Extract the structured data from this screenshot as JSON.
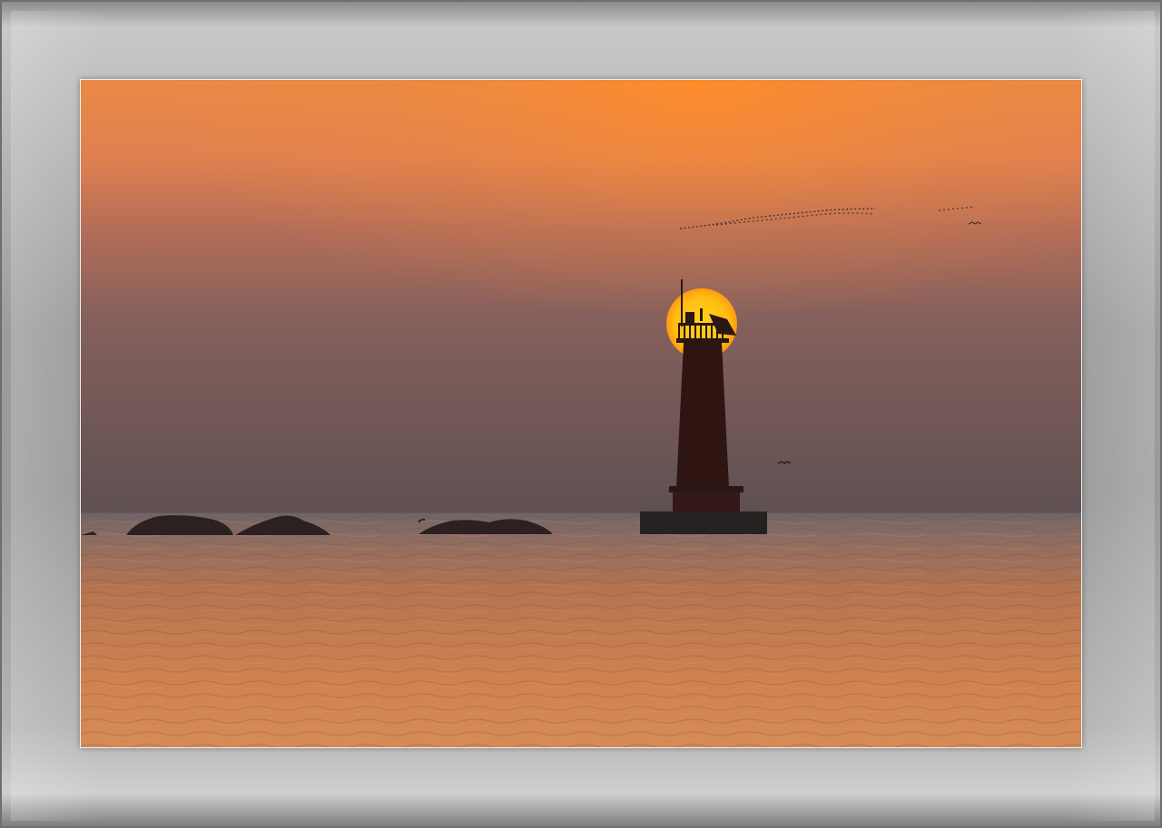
{
  "image": {
    "subject": "lighthouse",
    "colors": {
      "sky_top": "#f08a3c",
      "sky_mid": "#b86a52",
      "sky_low": "#6b5556",
      "sun": "#ffc21a",
      "sun_edge": "#ff9a10",
      "water_top": "#7a6e72",
      "water_mid": "#c77a4a",
      "water_low": "#d98d52",
      "silhouette": "#2a1614",
      "frame": "#a8a8a8"
    },
    "icons": [
      "lighthouse-silhouette",
      "sun-disc",
      "rock-silhouette",
      "bird-flock"
    ]
  }
}
